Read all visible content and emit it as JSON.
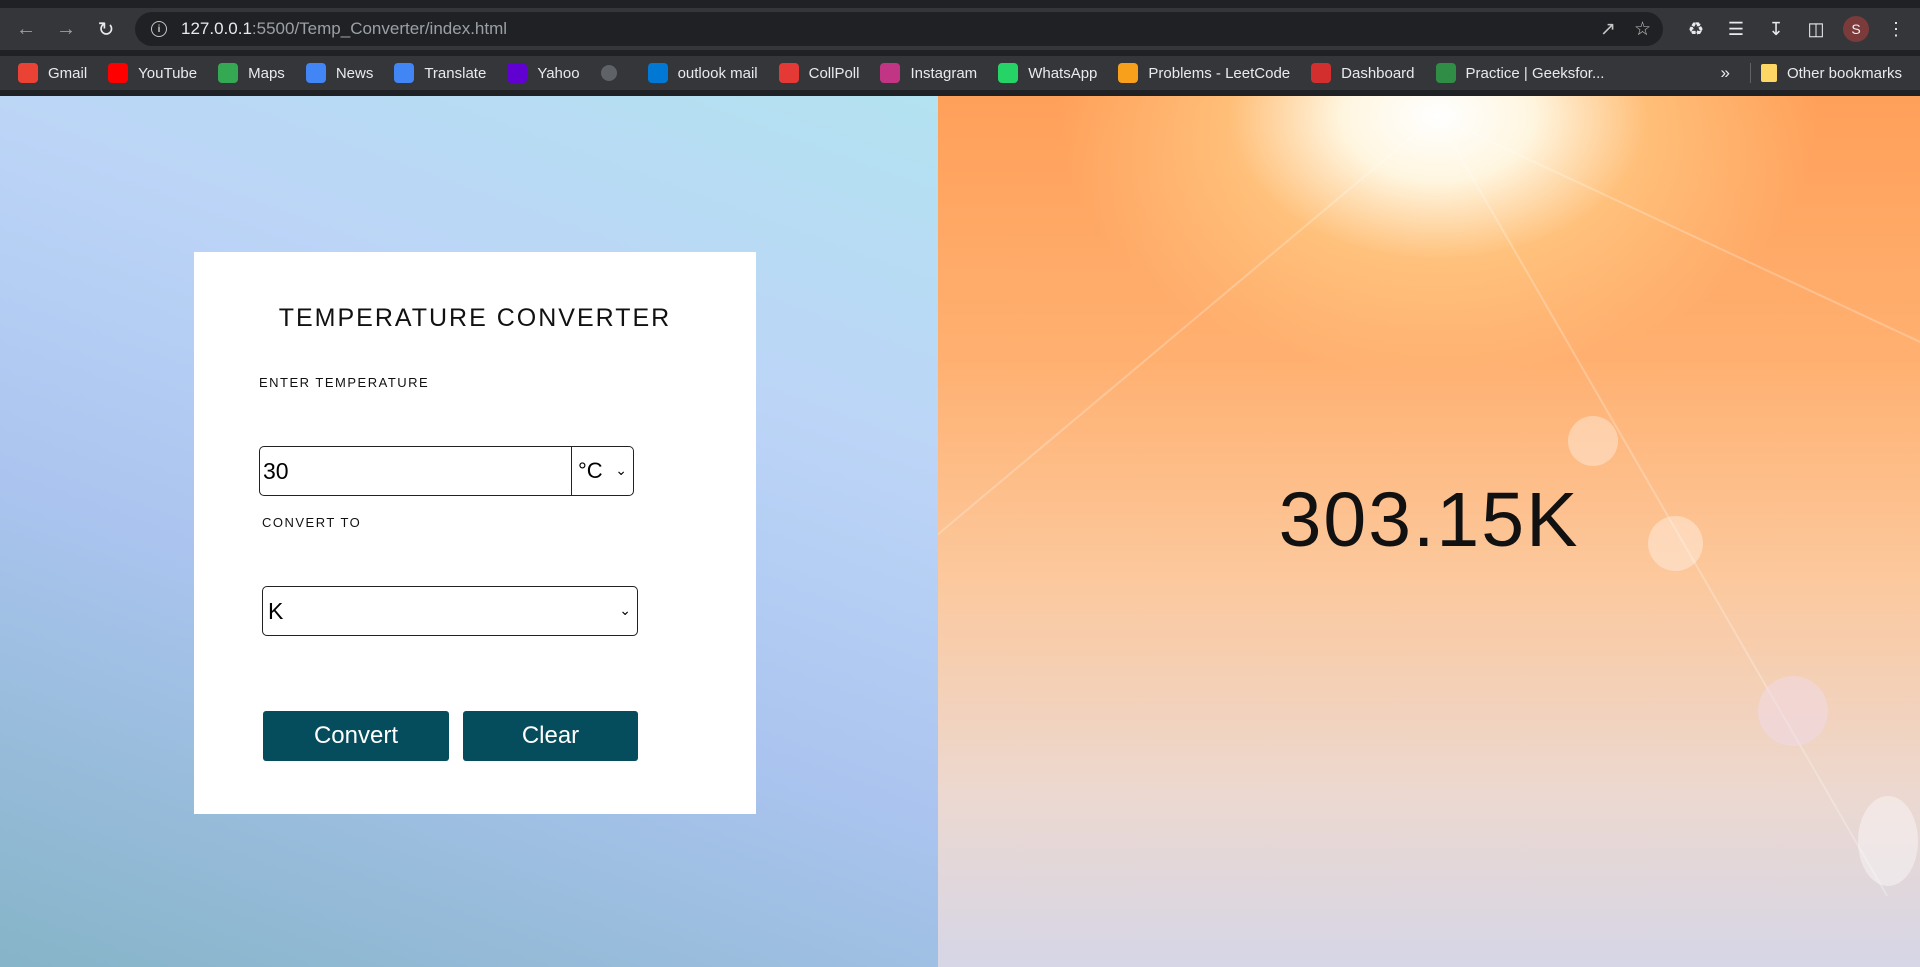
{
  "browser": {
    "url_host": "127.0.0.1",
    "url_rest": ":5500/Temp_Converter/index.html",
    "profile_initial": "S",
    "bookmarks": [
      {
        "label": "Gmail",
        "icon": "gmail-icon",
        "color": "#ea4335"
      },
      {
        "label": "YouTube",
        "icon": "youtube-icon",
        "color": "#ff0000"
      },
      {
        "label": "Maps",
        "icon": "maps-icon",
        "color": "#34a853"
      },
      {
        "label": "News",
        "icon": "news-icon",
        "color": "#4285f4"
      },
      {
        "label": "Translate",
        "icon": "translate-icon",
        "color": "#4285f4"
      },
      {
        "label": "Yahoo",
        "icon": "yahoo-icon",
        "color": "#6001d2"
      },
      {
        "label": "",
        "icon": "globe-icon",
        "color": "#5f6368"
      },
      {
        "label": "outlook mail",
        "icon": "outlook-icon",
        "color": "#0078d4"
      },
      {
        "label": "CollPoll",
        "icon": "collpoll-icon",
        "color": "#e53935"
      },
      {
        "label": "Instagram",
        "icon": "instagram-icon",
        "color": "#c13584"
      },
      {
        "label": "WhatsApp",
        "icon": "whatsapp-icon",
        "color": "#25d366"
      },
      {
        "label": "Problems - LeetCode",
        "icon": "leetcode-icon",
        "color": "#f89f1b"
      },
      {
        "label": "Dashboard",
        "icon": "dashboard-icon",
        "color": "#d32f2f"
      },
      {
        "label": "Practice | Geeksfor...",
        "icon": "geeksforgeeks-icon",
        "color": "#2f8d46"
      }
    ],
    "bookmarks_overflow": "»",
    "other_bookmarks": "Other bookmarks"
  },
  "app": {
    "title": "TEMPERATURE CONVERTER",
    "enter_label": "ENTER TEMPERATURE",
    "input_value": "30",
    "from_unit": "°C",
    "convert_to_label": "CONVERT TO",
    "to_unit": "K",
    "convert_button": "Convert",
    "clear_button": "Clear",
    "result": "303.15K"
  },
  "colors": {
    "button_bg": "#054d5c",
    "browser_toolbar": "#35363a"
  }
}
